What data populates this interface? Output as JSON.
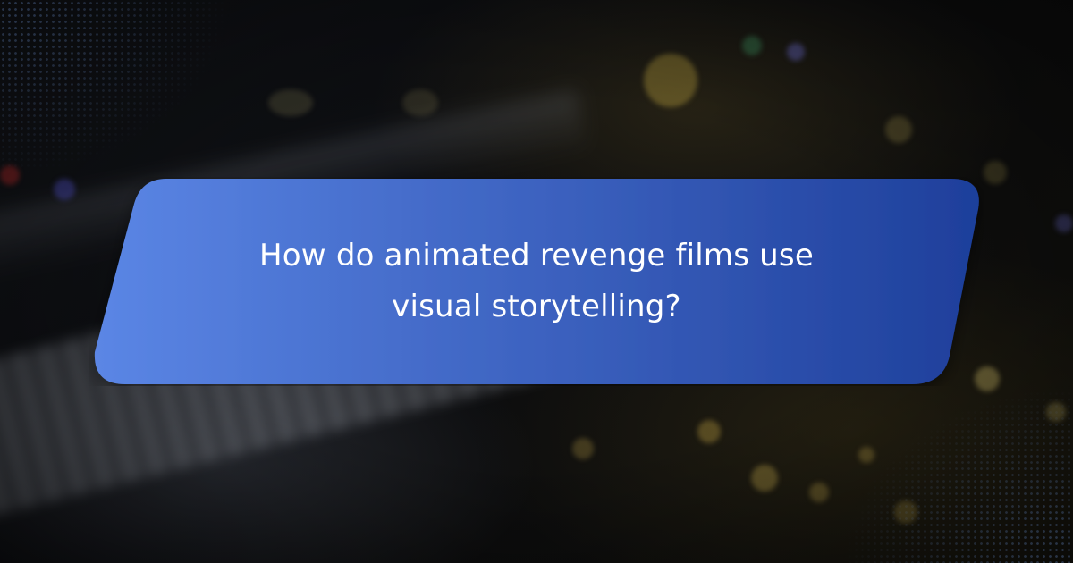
{
  "card": {
    "headline": "How do animated revenge films use visual storytelling?",
    "gradient_start": "#5b86e5",
    "gradient_end": "#1e3f9b"
  },
  "background": {
    "description_icon": "blurred-keyboard-bokeh",
    "accent_dots": "#7aa0e6"
  }
}
